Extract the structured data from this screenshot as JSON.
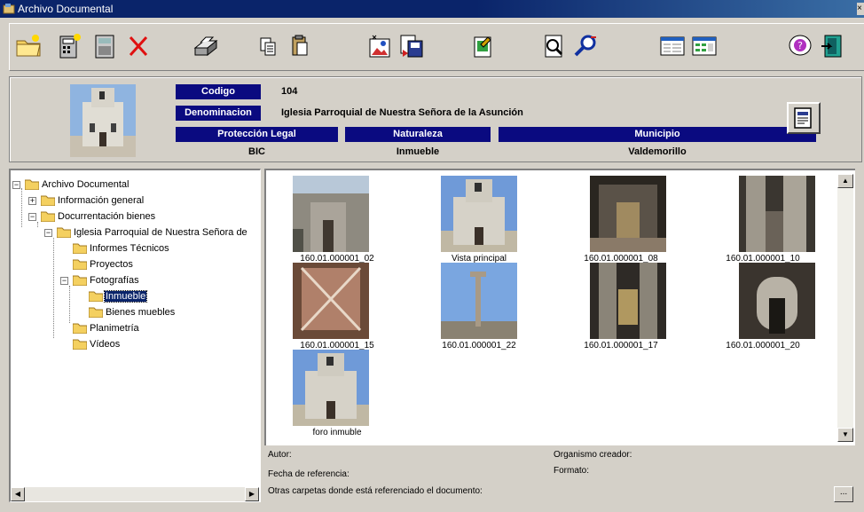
{
  "window": {
    "title": "Archivo Documental",
    "close_glyph": "×"
  },
  "toolbar": {
    "buttons": [
      {
        "name": "new-folder-icon"
      },
      {
        "name": "new-document-icon"
      },
      {
        "name": "calculator-icon"
      },
      {
        "name": "delete-icon"
      },
      {
        "name": "print-icon"
      },
      {
        "name": "copy-icon"
      },
      {
        "name": "paste-icon"
      },
      {
        "name": "image-edit-icon"
      },
      {
        "name": "save-icon"
      },
      {
        "name": "edit-document-icon"
      },
      {
        "name": "view-document-icon"
      },
      {
        "name": "search-icon"
      },
      {
        "name": "form-view-icon"
      },
      {
        "name": "grid-view-icon"
      },
      {
        "name": "help-icon"
      },
      {
        "name": "exit-icon"
      }
    ]
  },
  "header": {
    "codigo_label": "Codigo",
    "codigo_value": "104",
    "denominacion_label": "Denominacion",
    "denominacion_value": "Iglesia Parroquial de Nuestra Señora de la Asunción",
    "proteccion_label": "Protección Legal",
    "proteccion_value": "BIC",
    "naturaleza_label": "Naturaleza",
    "naturaleza_value": "Inmueble",
    "municipio_label": "Municipio",
    "municipio_value": "Valdemorillo"
  },
  "tree": {
    "nodes": [
      {
        "label": "Archivo Documental",
        "expander": "−"
      },
      {
        "label": "Información general",
        "expander": "+"
      },
      {
        "label": "Docurrentación bienes",
        "expander": "−"
      },
      {
        "label": "Iglesia Parroquial de Nuestra Señora de",
        "expander": "−"
      },
      {
        "label": "Informes Técnicos"
      },
      {
        "label": "Proyectos"
      },
      {
        "label": "Fotografías",
        "expander": "−"
      },
      {
        "label": "Inmueble",
        "selected": true
      },
      {
        "label": "Bienes muebles"
      },
      {
        "label": "Planimetría"
      },
      {
        "label": "Vídeos"
      }
    ],
    "scroll_left": "◀",
    "scroll_right": "▶"
  },
  "gallery": {
    "items": [
      {
        "caption": "160.01.000001_02"
      },
      {
        "caption": "Vista principal"
      },
      {
        "caption": "160.01.000001_08"
      },
      {
        "caption": "160.01.000001_10"
      },
      {
        "caption": "160.01.000001_15"
      },
      {
        "caption": "160.01.000001_22"
      },
      {
        "caption": "160.01.000001_17"
      },
      {
        "caption": "160.01.000001_20"
      },
      {
        "caption": "foro inmuble"
      }
    ],
    "scroll_up": "▲",
    "scroll_down": "▼"
  },
  "meta": {
    "autor_label": "Autor:",
    "organismo_label": "Organismo creador:",
    "fecha_label": "Fecha de referencia:",
    "formato_label": "Formato:",
    "otras_label": "Otras carpetas donde está referenciado el documento:",
    "more_label": "..."
  },
  "colors": {
    "title_bar": "#0a246a",
    "label_bg": "#0a0a80",
    "face": "#d4d0c8",
    "selection": "#0a246a"
  }
}
